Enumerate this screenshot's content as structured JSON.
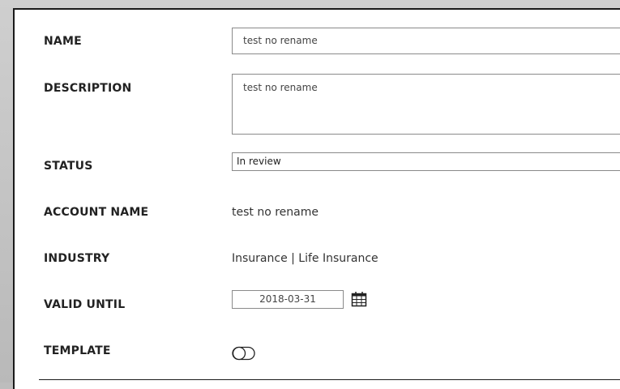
{
  "form": {
    "name": {
      "label": "NAME",
      "value": "test no rename"
    },
    "description": {
      "label": "DESCRIPTION",
      "value": "test no rename"
    },
    "status": {
      "label": "STATUS",
      "value": "In review"
    },
    "account_name": {
      "label": "ACCOUNT NAME",
      "value": "test no rename"
    },
    "industry": {
      "label": "INDUSTRY",
      "value": "Insurance | Life Insurance"
    },
    "valid_until": {
      "label": "VALID UNTIL",
      "value": "2018-03-31",
      "icon": "calendar-icon"
    },
    "template": {
      "label": "TEMPLATE",
      "enabled": false,
      "icon": "toggle-icon"
    }
  }
}
